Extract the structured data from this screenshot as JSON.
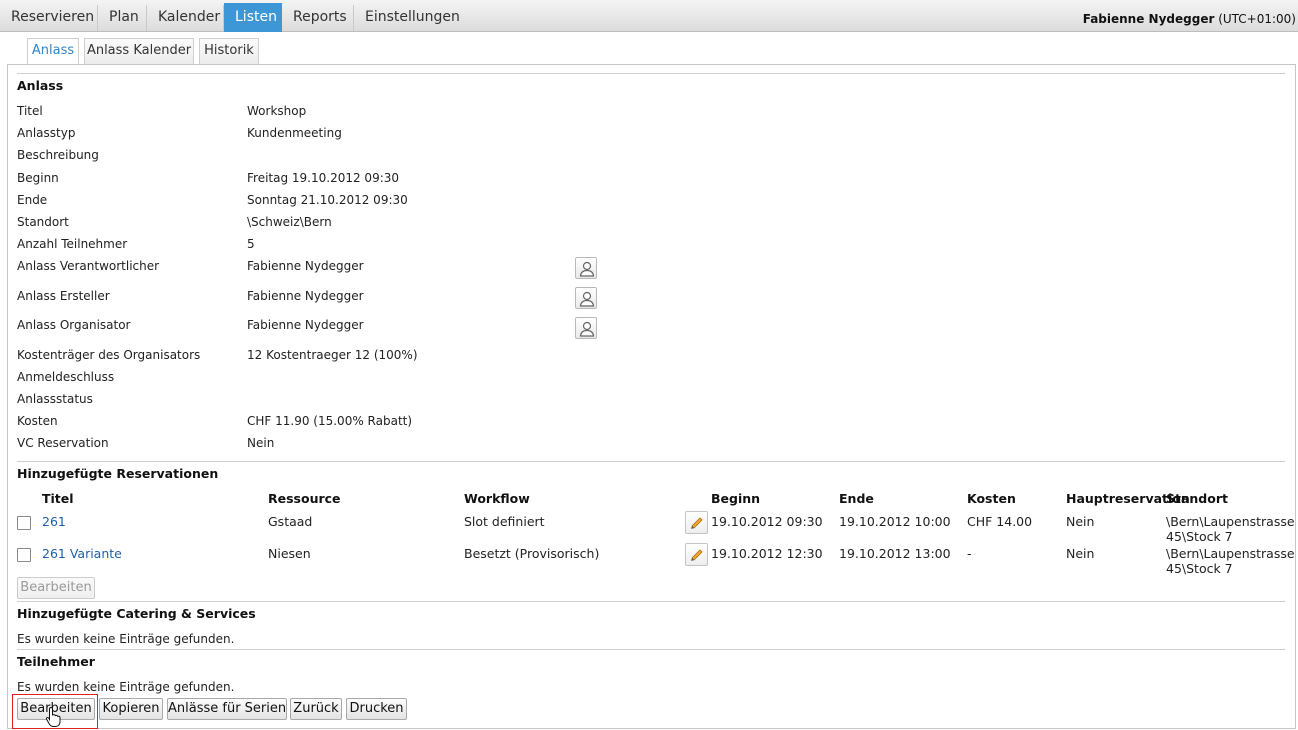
{
  "topnav": {
    "items": [
      {
        "label": "Reservieren",
        "active": false
      },
      {
        "label": "Plan",
        "active": false
      },
      {
        "label": "Kalender",
        "active": false
      },
      {
        "label": "Listen",
        "active": true
      },
      {
        "label": "Reports",
        "active": false
      },
      {
        "label": "Einstellungen",
        "active": false
      }
    ],
    "user_name": "Fabienne Nydegger",
    "user_tz": "(UTC+01:00)"
  },
  "subtabs": [
    {
      "label": "Anlass",
      "active": true
    },
    {
      "label": "Anlass Kalender",
      "active": false
    },
    {
      "label": "Historik",
      "active": false
    }
  ],
  "anlass": {
    "title": "Anlass",
    "fields": [
      {
        "label": "Titel",
        "value": "Workshop"
      },
      {
        "label": "Anlasstyp",
        "value": "Kundenmeeting"
      },
      {
        "label": "Beschreibung",
        "value": ""
      },
      {
        "label": "Beginn",
        "value": "Freitag 19.10.2012 09:30"
      },
      {
        "label": "Ende",
        "value": "Sonntag 21.10.2012 09:30"
      },
      {
        "label": "Standort",
        "value": "\\Schweiz\\Bern"
      },
      {
        "label": "Anzahl Teilnehmer",
        "value": "5"
      },
      {
        "label": "Anlass Verantwortlicher",
        "value": "Fabienne Nydegger"
      },
      {
        "label": "Anlass Ersteller",
        "value": "Fabienne Nydegger"
      },
      {
        "label": "Anlass Organisator",
        "value": "Fabienne Nydegger"
      },
      {
        "label": "Kostenträger des Organisators",
        "value": "12 Kostentraeger 12 (100%)"
      },
      {
        "label": "Anmeldeschluss",
        "value": ""
      },
      {
        "label": "Anlassstatus",
        "value": ""
      },
      {
        "label": "Kosten",
        "value": "CHF 11.90 (15.00% Rabatt)"
      },
      {
        "label": "VC Reservation",
        "value": "Nein"
      }
    ]
  },
  "reservations": {
    "title": "Hinzugefügte Reservationen",
    "columns": [
      "Titel",
      "Ressource",
      "Workflow",
      "Beginn",
      "Ende",
      "Kosten",
      "Hauptreservation",
      "Standort"
    ],
    "rows": [
      {
        "titel": "261",
        "ressource": "Gstaad",
        "workflow": "Slot definiert",
        "beginn": "19.10.2012 09:30",
        "ende": "19.10.2012 10:00",
        "kosten": "CHF 14.00",
        "haupt": "Nein",
        "standort": "\\Bern\\Laupenstrasse 45\\Stock 7"
      },
      {
        "titel": "261 Variante",
        "ressource": "Niesen",
        "workflow": "Besetzt (Provisorisch)",
        "beginn": "19.10.2012 12:30",
        "ende": "19.10.2012 13:00",
        "kosten": "-",
        "haupt": "Nein",
        "standort": "\\Bern\\Laupenstrasse 45\\Stock 7"
      }
    ],
    "edit_label": "Bearbeiten"
  },
  "catering": {
    "title": "Hinzugefügte Catering & Services",
    "empty": "Es wurden keine Einträge gefunden."
  },
  "teilnehmer": {
    "title": "Teilnehmer",
    "empty": "Es wurden keine Einträge gefunden."
  },
  "actions": {
    "bearbeiten": "Bearbeiten",
    "kopieren": "Kopieren",
    "serien": "Anlässe für Serien",
    "zurueck": "Zurück",
    "drucken": "Drucken"
  }
}
